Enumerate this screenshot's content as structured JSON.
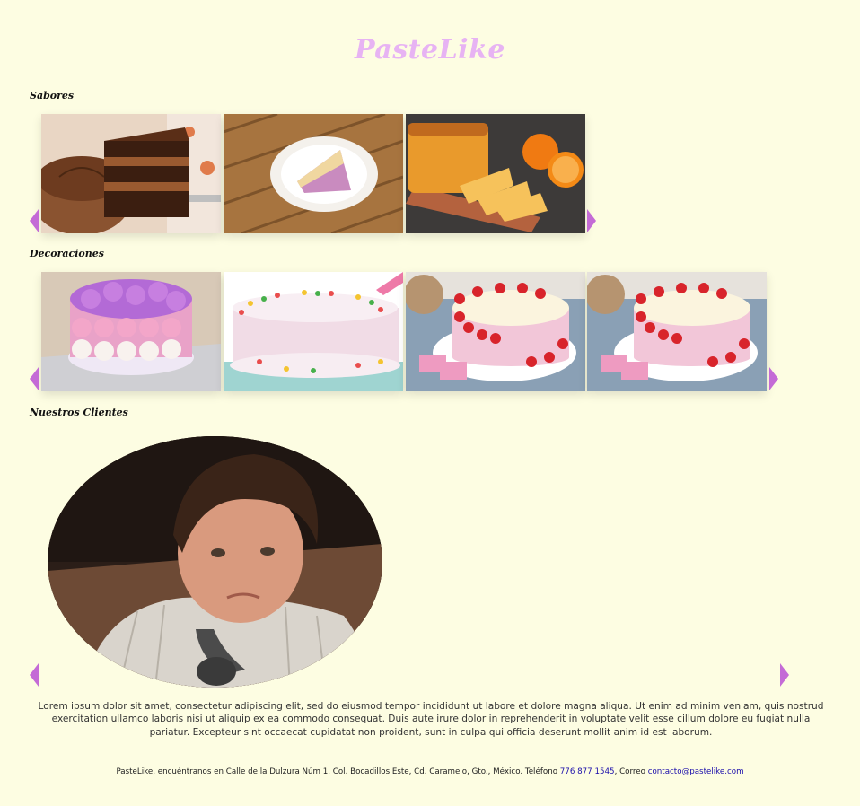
{
  "brand": {
    "name": "PasteLike"
  },
  "sections": {
    "sabores": {
      "title": "Sabores"
    },
    "decoraciones": {
      "title": "Decoraciones"
    },
    "clientes": {
      "title": "Nuestros Clientes"
    }
  },
  "clientes": {
    "text": "Lorem ipsum dolor sit amet, consectetur adipiscing elit, sed do eiusmod tempor incididunt ut labore et dolore magna aliqua. Ut enim ad minim veniam, quis nostrud exercitation ullamco laboris nisi ut aliquip ex ea commodo consequat. Duis aute irure dolor in reprehenderit in voluptate velit esse cillum dolore eu fugiat nulla pariatur. Excepteur sint occaecat cupidatat non proident, sunt in culpa qui officia deserunt mollit anim id est laborum."
  },
  "footer": {
    "prefix": "PasteLike, encuéntranos en Calle de la Dulzura Núm 1. Col. Bocadillos Este, Cd. Caramelo, Gto., México. Teléfono ",
    "phone": "776 877 1545",
    "mid": ", Correo ",
    "email": "contacto@pastelike.com"
  },
  "colors": {
    "background": "#fdfde2",
    "brand": "#e7b3f3",
    "arrow": "#c46bd6"
  },
  "icons": {
    "prev": "triangle-left-icon",
    "next": "triangle-right-icon"
  }
}
